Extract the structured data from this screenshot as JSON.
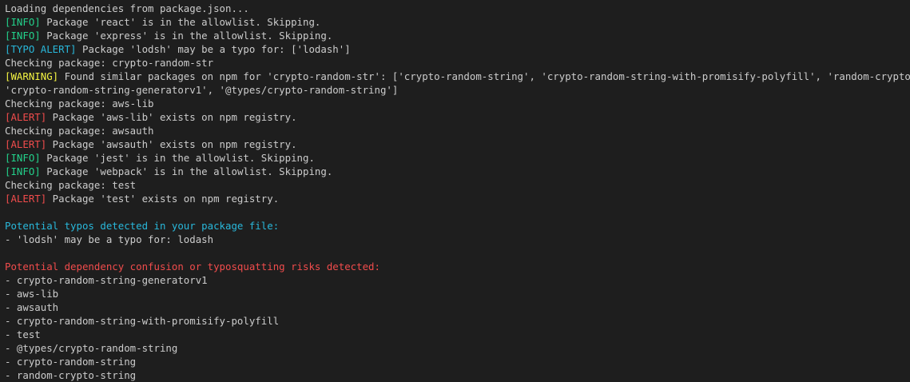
{
  "terminal": {
    "loading": "Loading dependencies from package.json...",
    "log": [
      {
        "tag": "[INFO]",
        "type": "info",
        "text": " Package 'react' is in the allowlist. Skipping."
      },
      {
        "tag": "[INFO]",
        "type": "info",
        "text": " Package 'express' is in the allowlist. Skipping."
      },
      {
        "tag": "[TYPO ALERT]",
        "type": "typo",
        "text": " Package 'lodsh' may be a typo for: ['lodash']"
      },
      {
        "tag": "",
        "type": "plain",
        "text": "Checking package: crypto-random-str"
      },
      {
        "tag": "[WARNING]",
        "type": "warning",
        "text": " Found similar packages on npm for 'crypto-random-str': ['crypto-random-string', 'crypto-random-string-with-promisify-polyfill', 'random-crypto-string',"
      },
      {
        "tag": "",
        "type": "plain",
        "text": "'crypto-random-string-generatorv1', '@types/crypto-random-string']"
      },
      {
        "tag": "",
        "type": "plain",
        "text": "Checking package: aws-lib"
      },
      {
        "tag": "[ALERT]",
        "type": "alert",
        "text": " Package 'aws-lib' exists on npm registry."
      },
      {
        "tag": "",
        "type": "plain",
        "text": "Checking package: awsauth"
      },
      {
        "tag": "[ALERT]",
        "type": "alert",
        "text": " Package 'awsauth' exists on npm registry."
      },
      {
        "tag": "[INFO]",
        "type": "info",
        "text": " Package 'jest' is in the allowlist. Skipping."
      },
      {
        "tag": "[INFO]",
        "type": "info",
        "text": " Package 'webpack' is in the allowlist. Skipping."
      },
      {
        "tag": "",
        "type": "plain",
        "text": "Checking package: test"
      },
      {
        "tag": "[ALERT]",
        "type": "alert",
        "text": " Package 'test' exists on npm registry."
      }
    ],
    "typos_heading": "Potential typos detected in your package file:",
    "typos": [
      "- 'lodsh' may be a typo for: lodash"
    ],
    "risks_heading": "Potential dependency confusion or typosquatting risks detected:",
    "risks": [
      "- crypto-random-string-generatorv1",
      "- aws-lib",
      "- awsauth",
      "- crypto-random-string-with-promisify-polyfill",
      "- test",
      "- @types/crypto-random-string",
      "- crypto-random-string",
      "- random-crypto-string"
    ]
  },
  "colors": {
    "background": "#1e1e1e",
    "text": "#cccccc",
    "info": "#23d18b",
    "typo": "#29b8db",
    "warning": "#f5f543",
    "alert": "#f14c4c"
  }
}
